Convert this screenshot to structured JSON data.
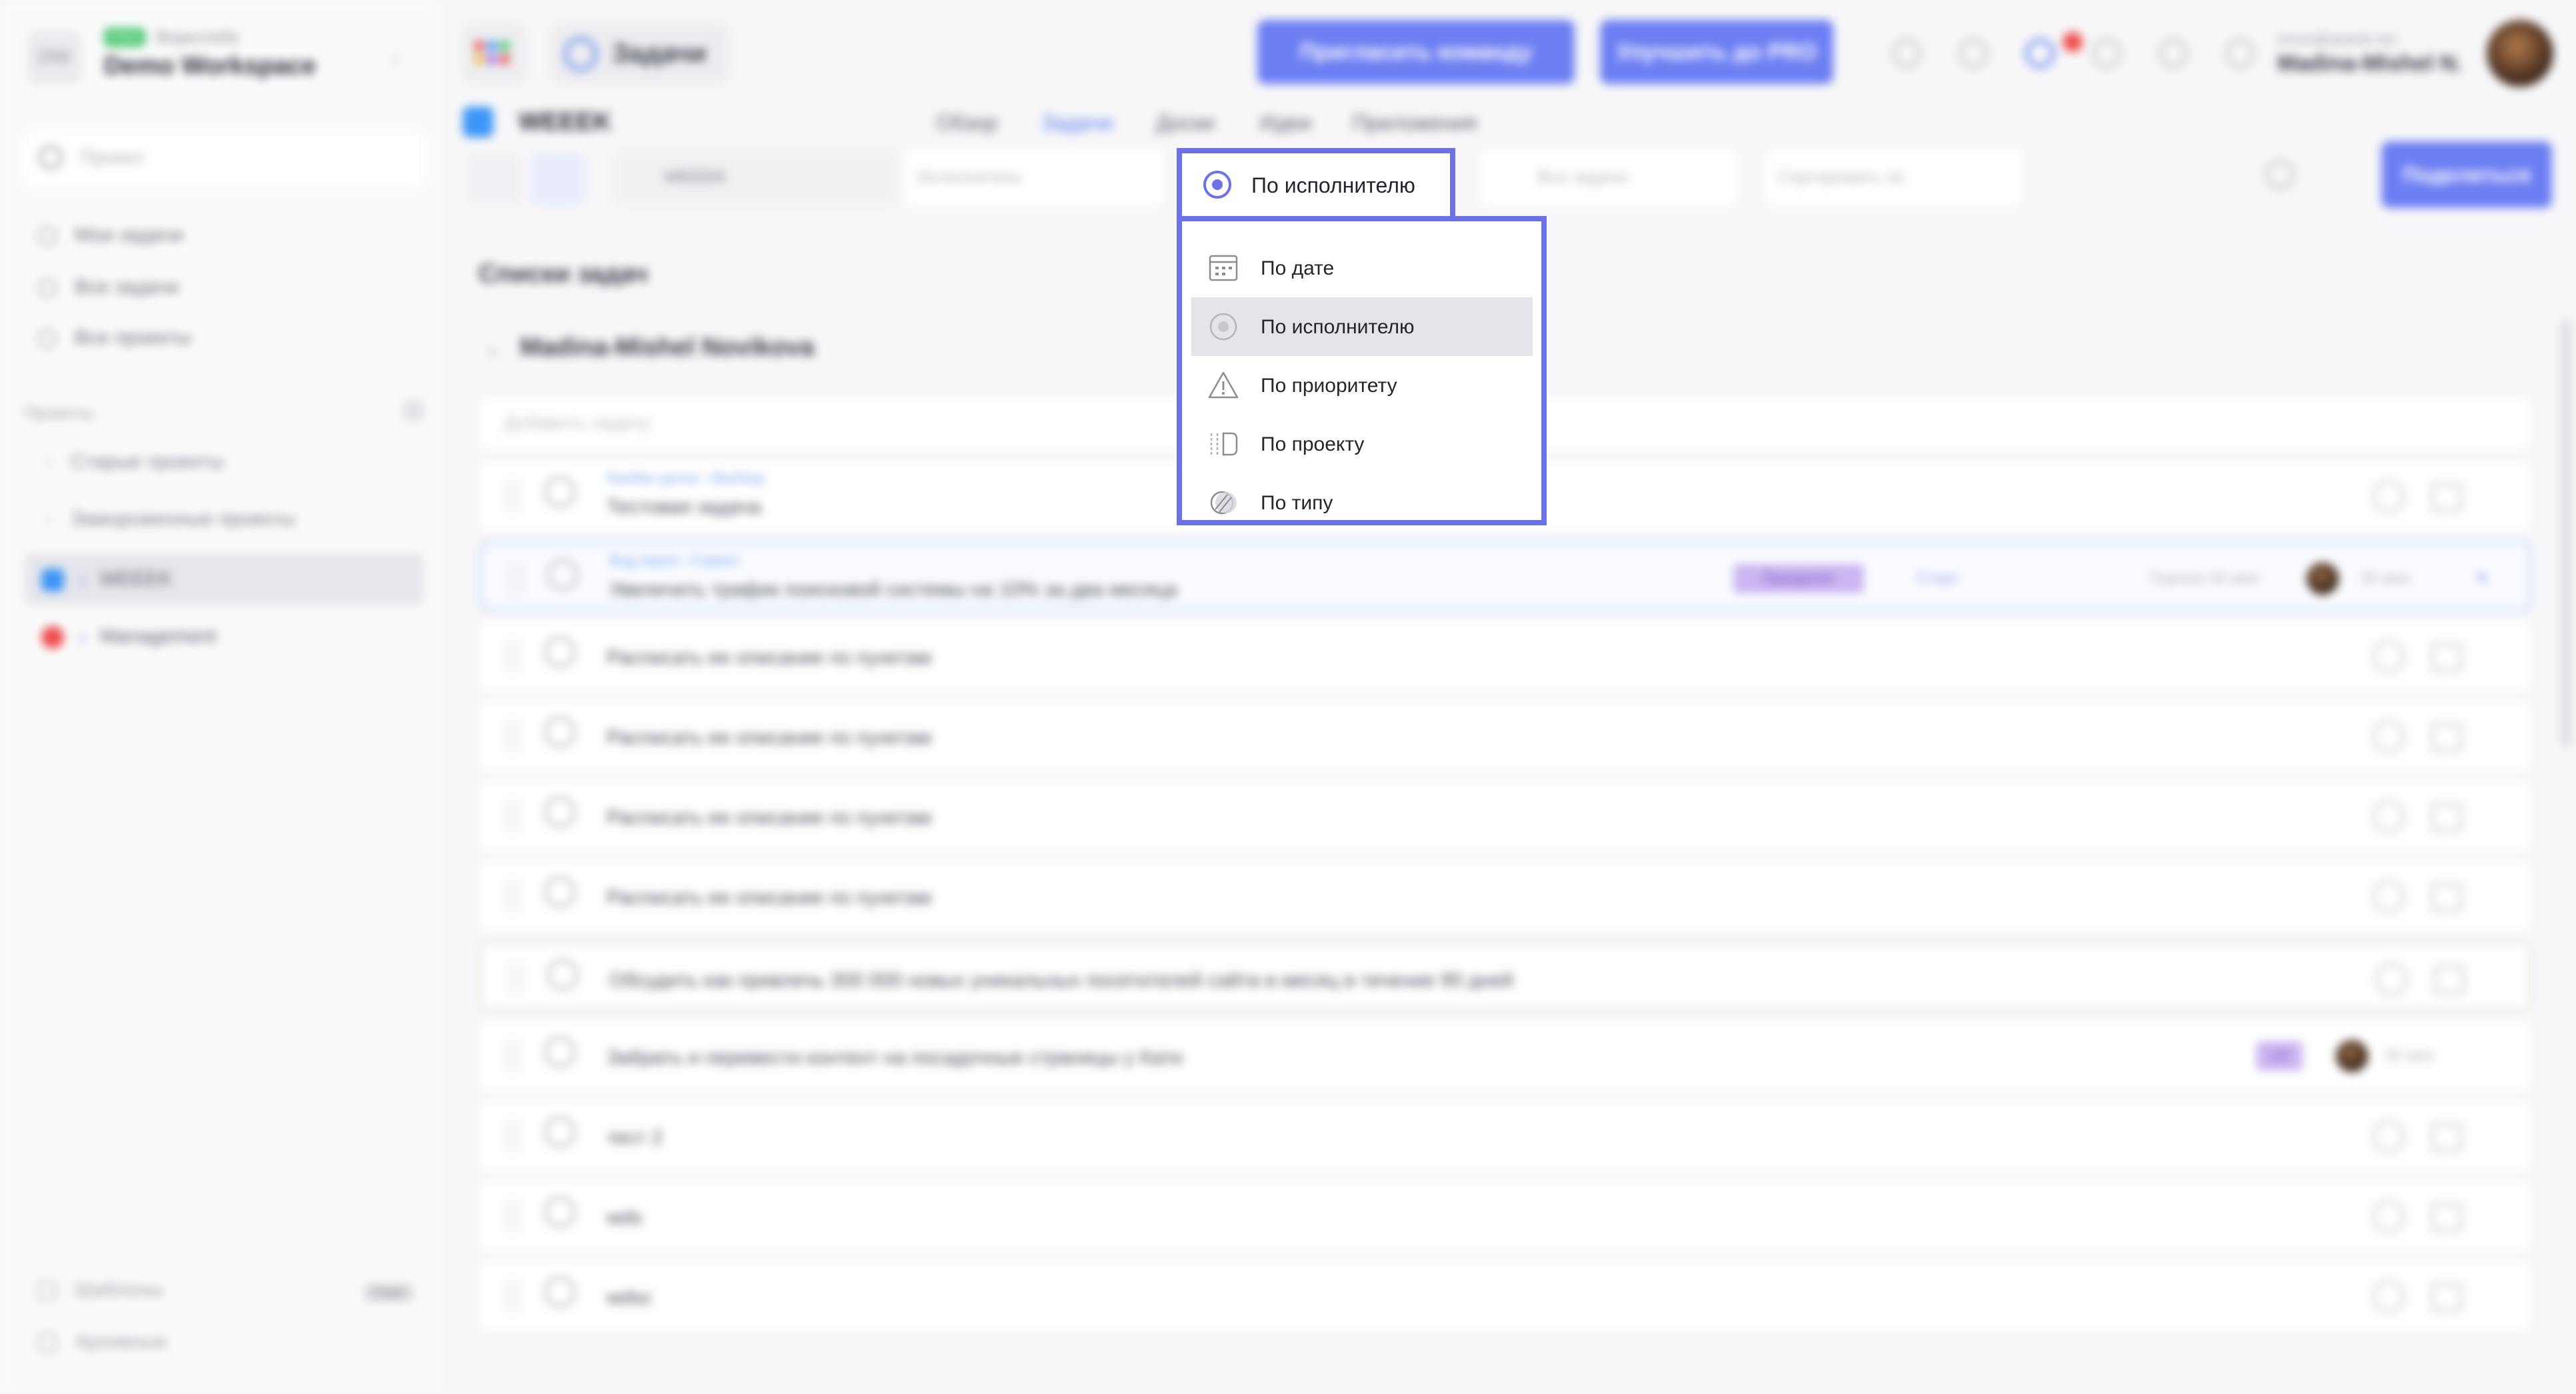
{
  "workspace": {
    "initials": "DW",
    "badge": "FREE",
    "caption": "Воркспейс",
    "name": "Demo Workspace"
  },
  "sidebar": {
    "search_placeholder": "Проект",
    "nav": [
      "Мои задачи",
      "Все задачи",
      "Все проекты"
    ],
    "section_label": "Проекты",
    "folders": [
      "Старые проекты",
      "Замороженные проекты"
    ],
    "projects": [
      {
        "name": "WEEEK",
        "color": "#3d95f7"
      },
      {
        "name": "Management",
        "color": "#ef4d4d"
      }
    ],
    "bottom": [
      "Шаблоны",
      "Архивные"
    ],
    "bottom_badge": "Скоро"
  },
  "header": {
    "section_title": "Задачи",
    "invite_button": "Пригласить команду",
    "upgrade_button": "Улучшить до PRO",
    "user_email": "mmm@weeek.net",
    "user_name": "Madina-Mishel N."
  },
  "project": {
    "name": "WEEEK",
    "tabs": [
      "Обзор",
      "Задачи",
      "Доски",
      "Идеи",
      "Приложения"
    ],
    "active_tab": "Задачи"
  },
  "toolbar": {
    "project_chip": "WEEEK",
    "assignee_placeholder": "Исполнитель",
    "filter_placeholder": "Все задачи",
    "sort_placeholder": "Сортировать по",
    "share_button": "Поделиться"
  },
  "list": {
    "title": "Списки задач",
    "group": "Madina-Mishel Novikova",
    "add_placeholder": "Добавить задачу",
    "rows": [
      {
        "crumb": "Канбан доска › Backlog",
        "title": "Тестовая задача"
      },
      {
        "crumb": "Bug report › Спринт",
        "title": "Увеличить трафик поисковой системы на 10% за два месяца",
        "tag": "Приоритет",
        "status": "Старт",
        "estimate": "Оценка 30 мин",
        "time": "30 мин"
      },
      {
        "title": "Расписать ее описание по пунктам"
      },
      {
        "title": "Расписать ее описание по пунктам"
      },
      {
        "title": "Расписать ее описание по пунктам"
      },
      {
        "title": "Расписать ее описание по пунктам"
      },
      {
        "title": "Обсудить как привлечь 300 000 новых уникальных посетителей сайта в месяц в течение 90 дней"
      },
      {
        "title": "Забрать и перевести контент на посадочные страницы у Кати",
        "tag": "UX",
        "time": "30 мин"
      },
      {
        "title": "тест 2"
      },
      {
        "title": "wds"
      },
      {
        "title": "wdsc"
      }
    ]
  },
  "sort_dropdown": {
    "current": "По исполнителю",
    "options": [
      {
        "label": "По дате",
        "icon": "calendar-icon"
      },
      {
        "label": "По исполнителю",
        "icon": "assignee-icon"
      },
      {
        "label": "По приоритету",
        "icon": "priority-warning-icon"
      },
      {
        "label": "По проекту",
        "icon": "project-icon"
      },
      {
        "label": "По типу",
        "icon": "type-icon"
      }
    ],
    "selected_index": 1,
    "accent": "#6b72e8"
  }
}
